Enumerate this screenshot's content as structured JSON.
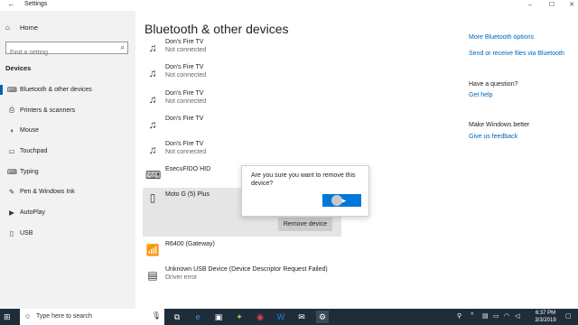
{
  "window": {
    "title": "Settings",
    "back_icon": "back-arrow-icon",
    "controls": [
      "minimize-icon",
      "maximize-icon",
      "close-icon"
    ]
  },
  "sidebar": {
    "home_label": "Home",
    "search_placeholder": "Find a setting",
    "section_title": "Devices",
    "items": [
      {
        "label": "Bluetooth & other devices",
        "icon": "bluetooth-devices-icon"
      },
      {
        "label": "Printers & scanners",
        "icon": "printer-icon"
      },
      {
        "label": "Mouse",
        "icon": "mouse-icon"
      },
      {
        "label": "Touchpad",
        "icon": "touchpad-icon"
      },
      {
        "label": "Typing",
        "icon": "keyboard-icon"
      },
      {
        "label": "Pen & Windows Ink",
        "icon": "pen-icon"
      },
      {
        "label": "AutoPlay",
        "icon": "autoplay-icon"
      },
      {
        "label": "USB",
        "icon": "usb-icon"
      }
    ]
  },
  "main": {
    "title": "Bluetooth & other devices",
    "devices": [
      {
        "name": "Don's Fire TV",
        "status": "Not connected",
        "icon": "media-device-icon"
      },
      {
        "name": "Don's Fire TV",
        "status": "Not connected",
        "icon": "media-device-icon"
      },
      {
        "name": "Don's Fire TV",
        "status": "Not connected",
        "icon": "media-device-icon"
      },
      {
        "name": "Don's Fire TV",
        "status": "",
        "icon": "media-device-icon"
      },
      {
        "name": "Don's Fire TV",
        "status": "Not connected",
        "icon": "media-device-icon"
      },
      {
        "name": "EsecuFIDO HID",
        "status": "",
        "icon": "keyboard-device-icon"
      },
      {
        "name": "Moto G (5) Plus",
        "status": "",
        "icon": "phone-icon"
      },
      {
        "name": "R6400 (Gateway)",
        "status": "",
        "icon": "wireless-icon"
      },
      {
        "name": "Unknown USB Device (Device Descriptor Request Failed)",
        "status": "Driver error",
        "icon": "generic-device-icon"
      }
    ],
    "remove_button": "Remove device",
    "dialog": {
      "message": "Are you sure you want to remove this device?",
      "confirm_label": ""
    }
  },
  "related": {
    "more_bluetooth": "More Bluetooth options",
    "send_receive": "Send or receive files via Bluetooth",
    "question_heading": "Have a question?",
    "get_help": "Get help",
    "better_heading": "Make Windows better",
    "feedback": "Give us feedback"
  },
  "taskbar": {
    "search_placeholder": "Type here to search",
    "time": "6:37 PM",
    "date": "3/3/2019",
    "apps": [
      "task-view-icon",
      "edge-icon",
      "store-icon",
      "maps-icon",
      "chrome-icon",
      "word-icon",
      "mail-icon",
      "file-explorer-icon",
      "settings-icon"
    ],
    "colors": {
      "taskbar_bg": "#1f2d3a",
      "accent": "#0078d7",
      "link": "#0063b1"
    }
  }
}
